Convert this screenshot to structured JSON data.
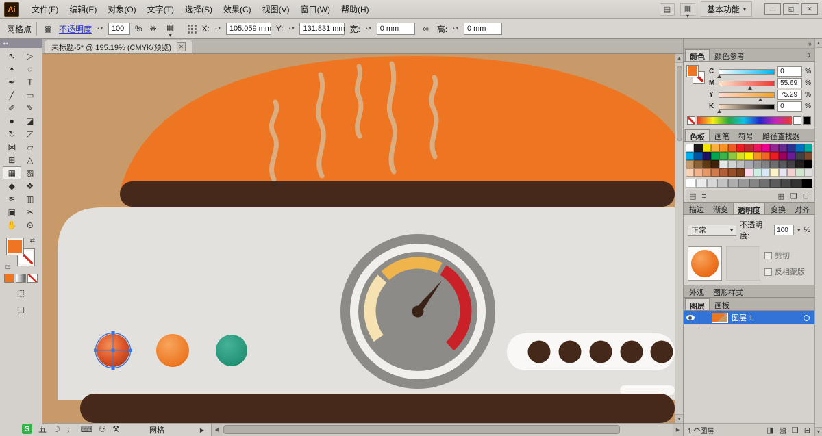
{
  "app": {
    "logo": "Ai",
    "workspace": "基本功能"
  },
  "menubar": {
    "items": [
      {
        "name": "file",
        "label": "文件(F)"
      },
      {
        "name": "edit",
        "label": "编辑(E)"
      },
      {
        "name": "object",
        "label": "对象(O)"
      },
      {
        "name": "type",
        "label": "文字(T)"
      },
      {
        "name": "select",
        "label": "选择(S)"
      },
      {
        "name": "effect",
        "label": "效果(C)"
      },
      {
        "name": "view",
        "label": "视图(V)"
      },
      {
        "name": "window",
        "label": "窗口(W)"
      },
      {
        "name": "help",
        "label": "帮助(H)"
      }
    ],
    "bridge_icon": "▤",
    "arrange_icon": "▦",
    "caret": "▾",
    "minimize": "—",
    "restore": "◱",
    "close": "✕"
  },
  "controlbar": {
    "context_label": "网格点",
    "transparency_grid_icon": "▩",
    "opacity_label": "不透明度",
    "opacity_value": "100",
    "percent": "%",
    "recolor_icon": "❋",
    "style_icon": "▦",
    "caret": "▾",
    "x_label": "X:",
    "x_value": "105.059 mm",
    "y_label": "Y:",
    "y_value": "131.831 mm",
    "w_label": "宽:",
    "w_value": "0 mm",
    "link_icon": "∞",
    "h_label": "高:",
    "h_value": "0 mm"
  },
  "document_tab": {
    "title": "未标题-5* @ 195.19% (CMYK/预览)",
    "close": "✕"
  },
  "toolbar": {
    "collapse": "◂◂",
    "tools": [
      {
        "name": "selection-tool",
        "glyph": "↖",
        "selected": false
      },
      {
        "name": "direct-selection-tool",
        "glyph": "▷",
        "selected": false
      },
      {
        "name": "magic-wand-tool",
        "glyph": "✶",
        "selected": false
      },
      {
        "name": "lasso-tool",
        "glyph": "◌",
        "selected": false
      },
      {
        "name": "pen-tool",
        "glyph": "✒",
        "selected": false
      },
      {
        "name": "type-tool",
        "glyph": "T",
        "selected": false
      },
      {
        "name": "line-segment-tool",
        "glyph": "╱",
        "selected": false
      },
      {
        "name": "rectangle-tool",
        "glyph": "▭",
        "selected": false
      },
      {
        "name": "paintbrush-tool",
        "glyph": "✐",
        "selected": false
      },
      {
        "name": "pencil-tool",
        "glyph": "✎",
        "selected": false
      },
      {
        "name": "blob-brush-tool",
        "glyph": "●",
        "selected": false
      },
      {
        "name": "eraser-tool",
        "glyph": "◪",
        "selected": false
      },
      {
        "name": "rotate-tool",
        "glyph": "↻",
        "selected": false
      },
      {
        "name": "scale-tool",
        "glyph": "◸",
        "selected": false
      },
      {
        "name": "width-tool",
        "glyph": "⋈",
        "selected": false
      },
      {
        "name": "free-transform-tool",
        "glyph": "▱",
        "selected": false
      },
      {
        "name": "shape-builder-tool",
        "glyph": "⊞",
        "selected": false
      },
      {
        "name": "perspective-grid-tool",
        "glyph": "△",
        "selected": false
      },
      {
        "name": "mesh-tool",
        "glyph": "▦",
        "selected": true
      },
      {
        "name": "gradient-tool",
        "glyph": "▨",
        "selected": false
      },
      {
        "name": "eyedropper-tool",
        "glyph": "◆",
        "selected": false
      },
      {
        "name": "blend-tool",
        "glyph": "❖",
        "selected": false
      },
      {
        "name": "symbol-sprayer-tool",
        "glyph": "≋",
        "selected": false
      },
      {
        "name": "column-graph-tool",
        "glyph": "▥",
        "selected": false
      },
      {
        "name": "artboard-tool",
        "glyph": "▣",
        "selected": false
      },
      {
        "name": "slice-tool",
        "glyph": "✂",
        "selected": false
      },
      {
        "name": "hand-tool",
        "glyph": "✋",
        "selected": false
      },
      {
        "name": "zoom-tool",
        "glyph": "⊙",
        "selected": false
      }
    ]
  },
  "colors": {
    "canvas_bg": "#c89a6a",
    "lid": "#ee7522",
    "steam": "#d9b58c",
    "band": "#46291a",
    "body": "#e3e1de",
    "strip": "#faf8f6",
    "holes": "#44281a",
    "gauge_outer": "#8d8b88",
    "gauge_ring": "#f1efec",
    "gauge_face": "#8d8b88",
    "arc_cream": "#f6e2b0",
    "arc_amber": "#efb44c",
    "arc_red": "#c92127",
    "needle": "#3a2316",
    "btn1_a": "#f2915a",
    "btn1_b": "#e05a2b",
    "btn1_c": "#b5401f",
    "btn2_a": "#f8a55c",
    "btn2_b": "#e9701a",
    "btn3_a": "#46b298",
    "btn3_b": "#1e8e6f",
    "selection": "#3b77dc",
    "layer_sel": "#3173d6",
    "link_blue": "#2d3bc0"
  },
  "panels": {
    "dock_collapse": "»",
    "color": {
      "tabs": [
        "颜色",
        "颜色参考"
      ],
      "active_tab": "颜色",
      "menu_icon": "⇕",
      "percent": "%",
      "sliders": [
        {
          "channel": "C",
          "value": "0"
        },
        {
          "channel": "M",
          "value": "55.69"
        },
        {
          "channel": "Y",
          "value": "75.29"
        },
        {
          "channel": "K",
          "value": "0"
        }
      ]
    },
    "swatches": {
      "tabs": [
        "色板",
        "画笔",
        "符号",
        "路径查找器"
      ],
      "active_tab": "色板",
      "colors": [
        "#ffffff",
        "#1a1a1a",
        "#f2e500",
        "#fbb03b",
        "#f7931e",
        "#f15a24",
        "#ed1c24",
        "#c1272d",
        "#ed145b",
        "#ec008c",
        "#92278f",
        "#662d91",
        "#2e3192",
        "#0071bc",
        "#00a99d",
        "#00aeef",
        "#0054a6",
        "#1b1464",
        "#00a651",
        "#39b54a",
        "#8dc63f",
        "#d9e021",
        "#fff200",
        "#f7941d",
        "#f26522",
        "#ed1c24",
        "#9e005d",
        "#6a1b9a",
        "#424242",
        "#7b4a2d",
        "#c49a6c",
        "#8c6239",
        "#603913",
        "#42210b",
        "#e6e7e8",
        "#d1d3d4",
        "#bcbec0",
        "#a7a9ac",
        "#939598",
        "#808285",
        "#6d6e71",
        "#58595b",
        "#414042",
        "#231f20",
        "#000000",
        "#f9d3b4",
        "#f2b28c",
        "#e59866",
        "#cf7b4e",
        "#b35f36",
        "#964f28",
        "#7a3f1d",
        "#ffd9ec",
        "#cdefe3",
        "#d9e8f5",
        "#fdf3c6",
        "#e8e3f4",
        "#f4d1d1",
        "#cfe6cc",
        "#e0e0e0"
      ],
      "grays": [
        "#ffffff",
        "#ebebeb",
        "#d6d6d6",
        "#c2c2c2",
        "#adadad",
        "#999999",
        "#858585",
        "#707070",
        "#5c5c5c",
        "#474747",
        "#333333",
        "#000000"
      ],
      "footer_icons": {
        "libraries": "▤",
        "group": "▦",
        "new": "❏",
        "delete": "⊟",
        "list": "≡"
      }
    },
    "transparency": {
      "tabs": [
        "描边",
        "渐变",
        "透明度"
      ],
      "active_tab": "透明度",
      "tabs2": [
        "变换",
        "对齐"
      ],
      "blend_mode": "正常",
      "caret": "▾",
      "opacity_label": "不透明度:",
      "opacity_value": "100",
      "percent": "%",
      "clip_label": "剪切",
      "invert_label": "反相蒙版"
    },
    "appearance": {
      "tabs": [
        "外观",
        "图形样式"
      ]
    },
    "layers": {
      "tabs": [
        "图层",
        "画板"
      ],
      "active_tab": "图层",
      "layer_name": "图层 1",
      "status": "1 个图层",
      "footer_icons": {
        "clip": "◨",
        "sublayer": "▧",
        "new": "❏",
        "delete": "⊟"
      }
    }
  },
  "statusbar": {
    "tool_display": "网格",
    "flyout": "▶"
  },
  "input_bar": {
    "logo": "S",
    "mode": "五",
    "moon": "☽",
    "punct": "，",
    "keyboard": "⌨",
    "user": "⚇",
    "wrench": "⚒"
  }
}
